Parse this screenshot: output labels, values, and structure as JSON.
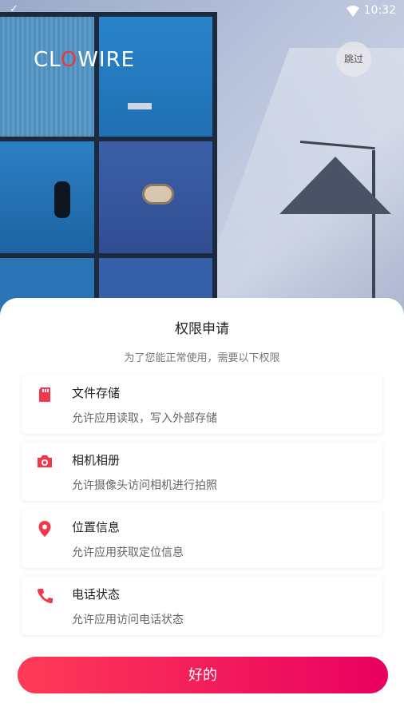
{
  "status_bar": {
    "time": "10:32"
  },
  "brand": {
    "logo_prefix": "CL",
    "logo_o": "O",
    "logo_suffix": "WIRE",
    "accent": "#e53945"
  },
  "skip": {
    "label": "跳过"
  },
  "dialog": {
    "title": "权限申请",
    "subtitle": "为了您能正常使用，需要以下权限",
    "permissions": [
      {
        "icon": "sd-card-icon",
        "title": "文件存储",
        "desc": "允许应用读取，写入外部存储"
      },
      {
        "icon": "camera-icon",
        "title": "相机相册",
        "desc": "允许摄像头访问相机进行拍照"
      },
      {
        "icon": "location-pin-icon",
        "title": "位置信息",
        "desc": "允许应用获取定位信息"
      },
      {
        "icon": "phone-icon",
        "title": "电话状态",
        "desc": "允许应用访问电话状态"
      }
    ],
    "confirm_label": "好的",
    "icon_color": "#f2384a",
    "button_gradient": [
      "#ff3b57",
      "#e8005f"
    ]
  }
}
